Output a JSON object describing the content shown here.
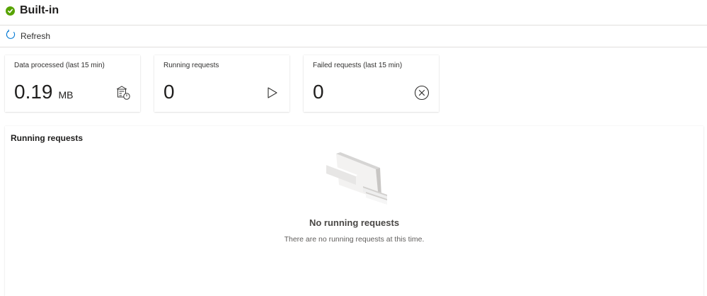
{
  "header": {
    "title": "Built-in",
    "status_icon": "check-circle-icon",
    "status_color": "#57a300"
  },
  "toolbar": {
    "refresh_label": "Refresh",
    "refresh_icon": "refresh-icon",
    "accent_color": "#0078d4"
  },
  "cards": [
    {
      "label": "Data processed (last 15 min)",
      "value": "0.19",
      "unit": "MB",
      "icon": "data-storage-icon"
    },
    {
      "label": "Running requests",
      "value": "0",
      "unit": "",
      "icon": "play-icon"
    },
    {
      "label": "Failed requests (last 15 min)",
      "value": "0",
      "unit": "",
      "icon": "dismiss-circle-icon"
    }
  ],
  "panel": {
    "title": "Running requests",
    "empty_title": "No running requests",
    "empty_description": "There are no running requests at this time.",
    "empty_icon": "empty-cards-illustration"
  }
}
